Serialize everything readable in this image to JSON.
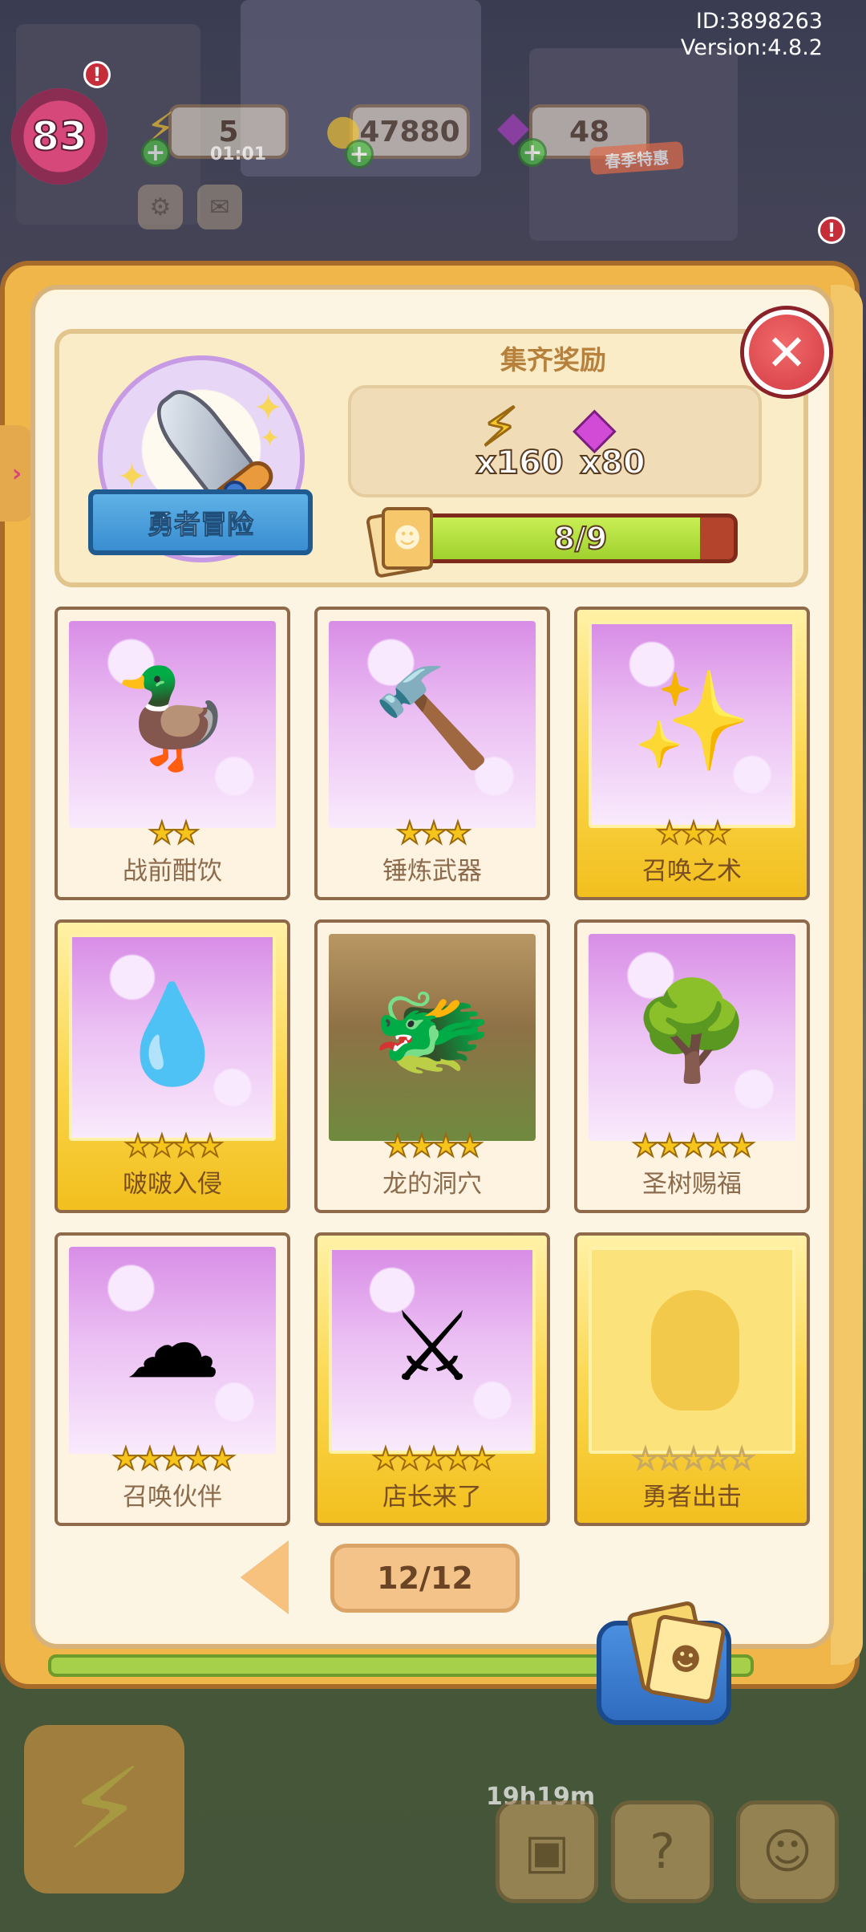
{
  "debug": {
    "id_text": "ID:3898263",
    "version_text": "Version:4.8.2"
  },
  "hud": {
    "level": "83",
    "energy": "5",
    "energy_timer": "01:01",
    "coins": "47880",
    "gems": "48",
    "event_badge": "春季特惠",
    "alert_mark": "!"
  },
  "collection": {
    "theme_name": "勇者冒险",
    "reward_title": "集齐奖励",
    "rewards": [
      {
        "icon": "energy-bolt-icon",
        "count": "x160"
      },
      {
        "icon": "purple-gem-icon",
        "count": "x80"
      }
    ],
    "progress_text": "8/9",
    "progress_fraction": 0.889
  },
  "cards": [
    {
      "name": "战前酣饮",
      "stars": "★★",
      "star_count": 2,
      "gold": false,
      "owned": true
    },
    {
      "name": "锤炼武器",
      "stars": "★★★",
      "star_count": 3,
      "gold": false,
      "owned": true
    },
    {
      "name": "召唤之术",
      "stars": "★★★",
      "star_count": 3,
      "gold": true,
      "owned": true
    },
    {
      "name": "啵啵入侵",
      "stars": "★★★★",
      "star_count": 4,
      "gold": true,
      "owned": true
    },
    {
      "name": "龙的洞穴",
      "stars": "★★★★",
      "star_count": 4,
      "gold": false,
      "owned": true
    },
    {
      "name": "圣树赐福",
      "stars": "★★★★★",
      "star_count": 5,
      "gold": false,
      "owned": true
    },
    {
      "name": "召唤伙伴",
      "stars": "★★★★★",
      "star_count": 5,
      "gold": false,
      "owned": true
    },
    {
      "name": "店长来了",
      "stars": "★★★★★",
      "star_count": 5,
      "gold": true,
      "owned": true
    },
    {
      "name": "勇者出击",
      "stars": "☆☆☆☆☆",
      "star_count": 5,
      "gold": true,
      "owned": false
    }
  ],
  "pagination": {
    "page_text": "12/12"
  },
  "bottom": {
    "timer": "19h19m"
  },
  "colors": {
    "accent_gold": "#f2bf1e",
    "progress_green": "#9fd12d",
    "close_red": "#d33b44",
    "panel_cream": "#fdf5e4"
  }
}
